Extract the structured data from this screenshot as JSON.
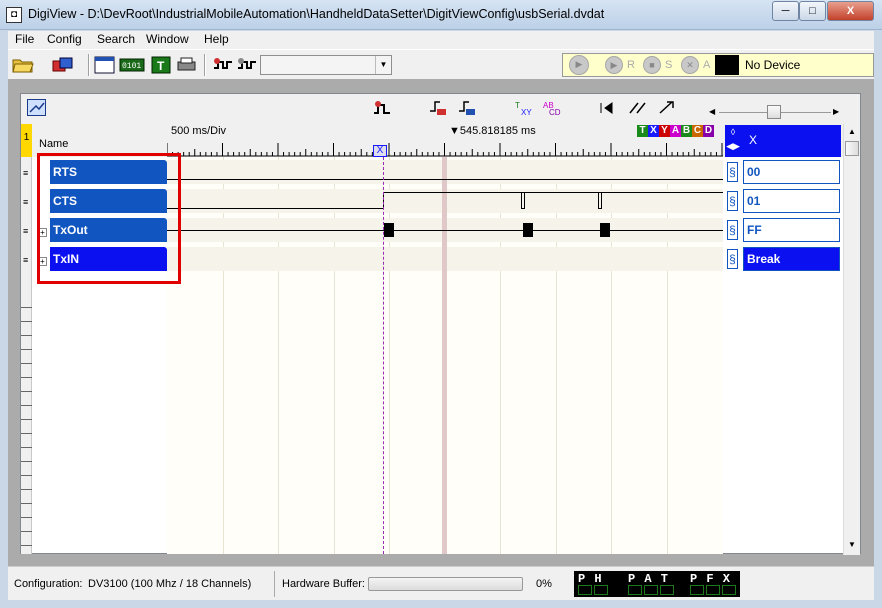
{
  "window": {
    "title": "DigiView - D:\\DevRoot\\IndustrialMobileAutomation\\HandheldDataSetter\\DigitViewConfig\\usbSerial.dvdat",
    "min_label": "─",
    "max_label": "□",
    "close_label": "X"
  },
  "menu": {
    "items": [
      "File",
      "Config",
      "Search",
      "Window",
      "Help"
    ]
  },
  "toolbar": {
    "run_buttons": [
      "R",
      "S",
      "A"
    ],
    "device_label": "No Device",
    "combo_value": ""
  },
  "waveform": {
    "name_header": "Name",
    "scale": "500 ms/Div",
    "cursor_time": "▼545.818185 ms",
    "cursor_tag": "X",
    "value_header": "X",
    "color_tabs": [
      {
        "label": "T",
        "color": "#1a8a1a"
      },
      {
        "label": "X",
        "color": "#1a1aff"
      },
      {
        "label": "Y",
        "color": "#cc0000"
      },
      {
        "label": "A",
        "color": "#cc00cc"
      },
      {
        "label": "B",
        "color": "#1a8a1a"
      },
      {
        "label": "C",
        "color": "#cc6600"
      },
      {
        "label": "D",
        "color": "#8800aa"
      }
    ],
    "row_number": "1",
    "channels": [
      {
        "name": "RTS",
        "value": "00",
        "selected": false
      },
      {
        "name": "CTS",
        "value": "01",
        "selected": false
      },
      {
        "name": "TxOut",
        "value": "FF",
        "selected": false
      },
      {
        "name": "TxIN",
        "value": "Break",
        "selected": true
      }
    ],
    "icons": [
      "zoom-fit-icon",
      "trigger-icon",
      "edge-in-icon",
      "edge-out-icon",
      "txy-icon",
      "abcd-icon",
      "prev-edge-icon",
      "next-edge-icon",
      "jump-icon"
    ]
  },
  "status": {
    "configuration_label": "Configuration:",
    "configuration_value": "DV3100 (100 Mhz / 18 Channels)",
    "hardware_buffer_label": "Hardware Buffer:",
    "hardware_buffer_pct": "0%",
    "hardware_buffer_fill": 0,
    "leds": [
      "P H",
      "P A T",
      "P F X"
    ]
  }
}
